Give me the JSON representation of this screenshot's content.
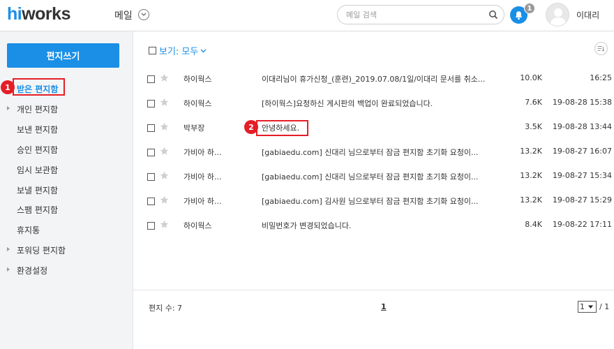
{
  "header": {
    "logo_prefix": "hi",
    "logo_suffix": "works",
    "app_name": "메일",
    "search_placeholder": "메일 검색",
    "notification_count": "1",
    "user_name": "이대리"
  },
  "sidebar": {
    "compose_label": "편지쓰기",
    "folders": [
      {
        "label": "받은 편지함",
        "active": true,
        "expandable": false
      },
      {
        "label": "개인 편지함",
        "active": false,
        "expandable": true
      },
      {
        "label": "보낸 편지함",
        "active": false,
        "expandable": false
      },
      {
        "label": "승인 편지함",
        "active": false,
        "expandable": false
      },
      {
        "label": "임시 보관함",
        "active": false,
        "expandable": false
      },
      {
        "label": "보낼 편지함",
        "active": false,
        "expandable": false
      },
      {
        "label": "스팸 편지함",
        "active": false,
        "expandable": false
      },
      {
        "label": "휴지통",
        "active": false,
        "expandable": false
      },
      {
        "label": "포워딩 편지함",
        "active": false,
        "expandable": true
      },
      {
        "label": "환경설정",
        "active": false,
        "expandable": true
      }
    ]
  },
  "annotations": {
    "marker_1": "1",
    "marker_2": "2"
  },
  "main": {
    "view_label": "보기: 모두",
    "emails": [
      {
        "sender": "하이웍스",
        "subject": "이대리님이 휴가신청_(훈련)_2019.07.08/1일/이대리 문서를 취소...",
        "size": "10.0K",
        "date": "16:25"
      },
      {
        "sender": "하이웍스",
        "subject": "[하이웍스]요청하신 게시판의 백업이 완료되었습니다.",
        "size": "7.6K",
        "date": "19-08-28 15:38"
      },
      {
        "sender": "박부장",
        "subject": "안녕하세요.",
        "size": "3.5K",
        "date": "19-08-28 13:44"
      },
      {
        "sender": "가비아 하...",
        "subject": "[gabiaedu.com] 신대리 님으로부터 잠금 편지함 초기화 요청이...",
        "size": "13.2K",
        "date": "19-08-27 16:07"
      },
      {
        "sender": "가비아 하...",
        "subject": "[gabiaedu.com] 신대리 님으로부터 잠금 편지함 초기화 요청이...",
        "size": "13.2K",
        "date": "19-08-27 15:34"
      },
      {
        "sender": "가비아 하...",
        "subject": "[gabiaedu.com] 김사원 님으로부터 잠금 편지함 초기화 요청이...",
        "size": "13.2K",
        "date": "19-08-27 15:29"
      },
      {
        "sender": "하이웍스",
        "subject": "비밀번호가 변경되었습니다.",
        "size": "8.4K",
        "date": "19-08-22 17:11"
      }
    ],
    "footer": {
      "mail_count": "편지 수: 7",
      "page_link": "1",
      "page_select": "1",
      "page_total": "/ 1"
    }
  },
  "colors": {
    "accent": "#1b8fe6",
    "annotation_red": "#e41e26"
  }
}
